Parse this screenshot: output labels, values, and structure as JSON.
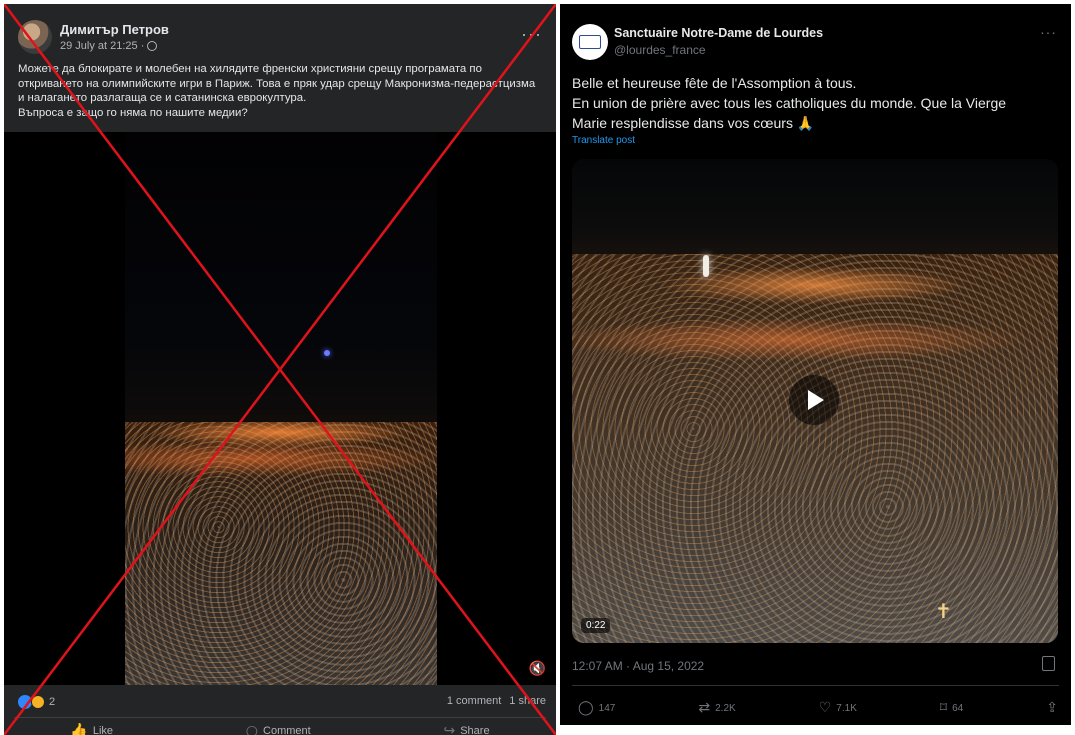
{
  "facebook": {
    "author": "Димитър Петров",
    "date": "29 July at 21:25 ·",
    "more": "···",
    "post_lines": [
      "Можете да блокирате и молебен на хилядите френски християни срещу програмата по",
      "откриването на олимпийските игри в Париж. Това е пряк удар срещу Макронизма-педерастцизма",
      "и налагането разлагаща се и сатанинска еврокултура.",
      "Въпроса е защо го няма по нашите медии?"
    ],
    "reaction_count": "2",
    "comments": "1 comment",
    "shares": "1 share",
    "actions": {
      "like": "Like",
      "comment": "Comment",
      "share": "Share"
    }
  },
  "twitter": {
    "account_name": "Sanctuaire Notre-Dame de Lourdes",
    "handle": "@lourdes_france",
    "more": "···",
    "text_lines": [
      "Belle et heureuse fête de l'Assomption à tous.",
      "En union de prière avec tous les catholiques du monde. Que la Vierge",
      "Marie resplendisse dans vos cœurs 🙏"
    ],
    "translate": "Translate post",
    "video_duration": "0:22",
    "timestamp": "12:07 AM · Aug 15, 2022",
    "replies": "147",
    "reposts": "2.2K",
    "likes": "7.1K",
    "bookmarks": "64"
  },
  "overlay": {
    "cross_color": "#e0131c"
  }
}
